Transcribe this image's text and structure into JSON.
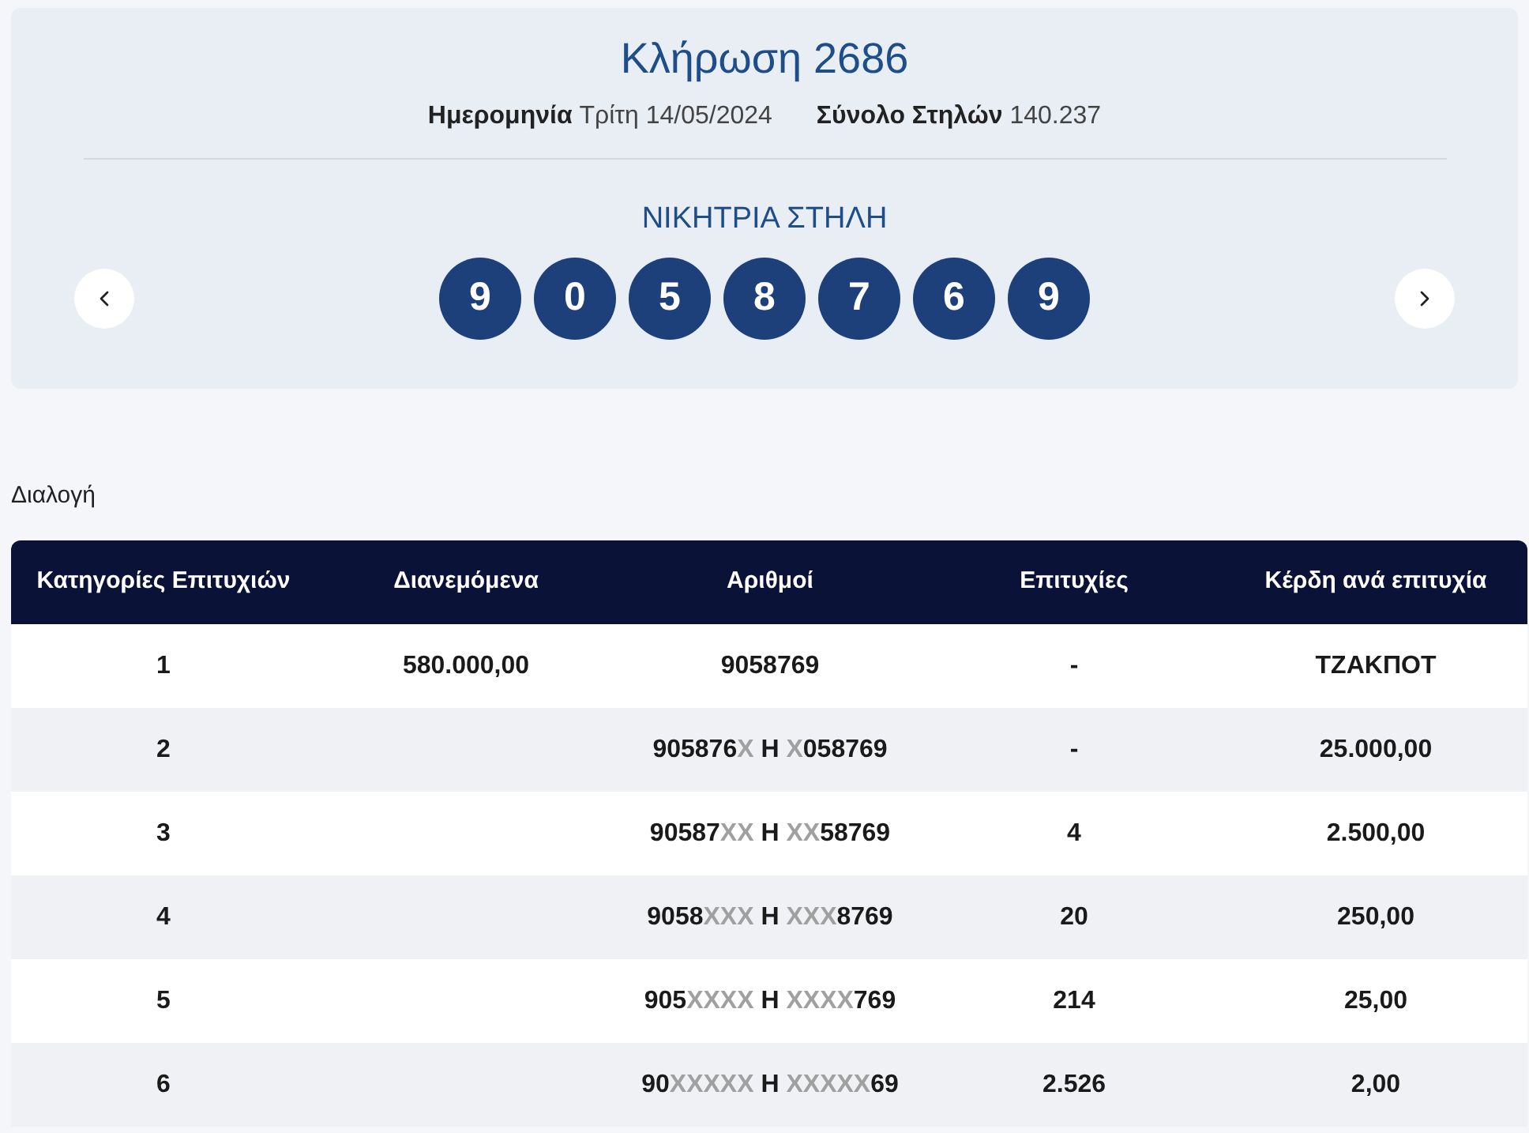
{
  "draw": {
    "title": "Κλήρωση 2686",
    "date_label": "Ημερομηνία",
    "date_value": "Τρίτη 14/05/2024",
    "total_label": "Σύνολο Στηλών",
    "total_value": "140.237",
    "winning_label": "ΝΙΚΗΤΡΙΑ ΣΤΗΛΗ",
    "balls": [
      "9",
      "0",
      "5",
      "8",
      "7",
      "6",
      "9"
    ]
  },
  "section_label": "Διαλογή",
  "table": {
    "columns": [
      "Κατηγορίες Επιτυχιών",
      "Διανεμόμενα",
      "Αριθμοί",
      "Επιτυχίες",
      "Κέρδη ανά επιτυχία"
    ],
    "rows": [
      {
        "category": "1",
        "distributed": "580.000,00",
        "numbers": [
          {
            "text": "9058769",
            "masked": false
          }
        ],
        "winners": "-",
        "prize": "ΤΖΑΚΠΟΤ"
      },
      {
        "category": "2",
        "numbers": [
          {
            "text": "905876",
            "masked": false
          },
          {
            "text": "X",
            "masked": true
          },
          {
            "text": " Η ",
            "masked": false
          },
          {
            "text": "X",
            "masked": true
          },
          {
            "text": "058769",
            "masked": false
          }
        ],
        "winners": "-",
        "prize": "25.000,00"
      },
      {
        "category": "3",
        "numbers": [
          {
            "text": "90587",
            "masked": false
          },
          {
            "text": "XX",
            "masked": true
          },
          {
            "text": " Η ",
            "masked": false
          },
          {
            "text": "XX",
            "masked": true
          },
          {
            "text": "58769",
            "masked": false
          }
        ],
        "winners": "4",
        "prize": "2.500,00"
      },
      {
        "category": "4",
        "numbers": [
          {
            "text": "9058",
            "masked": false
          },
          {
            "text": "XXX",
            "masked": true
          },
          {
            "text": " Η ",
            "masked": false
          },
          {
            "text": "XXX",
            "masked": true
          },
          {
            "text": "8769",
            "masked": false
          }
        ],
        "winners": "20",
        "prize": "250,00"
      },
      {
        "category": "5",
        "numbers": [
          {
            "text": "905",
            "masked": false
          },
          {
            "text": "XXXX",
            "masked": true
          },
          {
            "text": " Η ",
            "masked": false
          },
          {
            "text": "XXXX",
            "masked": true
          },
          {
            "text": "769",
            "masked": false
          }
        ],
        "winners": "214",
        "prize": "25,00"
      },
      {
        "category": "6",
        "numbers": [
          {
            "text": "90",
            "masked": false
          },
          {
            "text": "XXXXX",
            "masked": true
          },
          {
            "text": " Η ",
            "masked": false
          },
          {
            "text": "XXXXX",
            "masked": true
          },
          {
            "text": "69",
            "masked": false
          }
        ],
        "winners": "2.526",
        "prize": "2,00"
      }
    ]
  }
}
